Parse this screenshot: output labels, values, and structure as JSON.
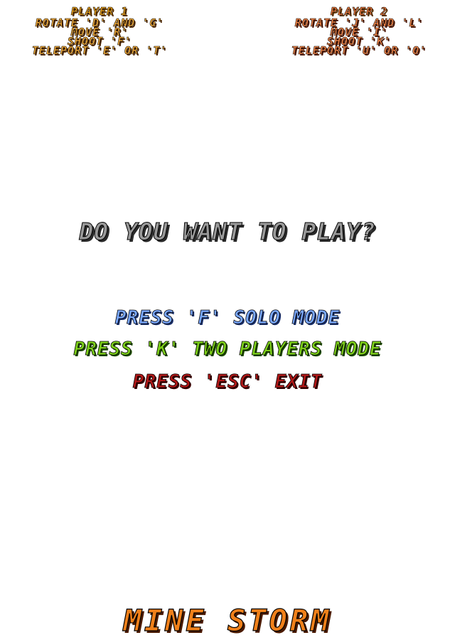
{
  "player1": {
    "title": "PLAYER 1",
    "rotate": "ROTATE 'D' AND 'G'",
    "move": "MOVE 'R'",
    "shoot": "SHOOT 'F'",
    "teleport": "TELEPORT 'E' OR 'T'"
  },
  "player2": {
    "title": "PLAYER 2",
    "rotate": "ROTATE 'J' AND 'L'",
    "move": "MOVE 'I'",
    "shoot": "SHOOT 'K'",
    "teleport": "TELEPORT 'U' OR 'O'"
  },
  "prompt": "DO YOU WANT TO PLAY?",
  "menu": {
    "solo": "PRESS 'F' SOLO MODE",
    "two_players": "PRESS 'K' TWO PLAYERS MODE",
    "exit": "PRESS 'ESC' EXIT"
  },
  "game_title": "MINE STORM",
  "colors": {
    "player_text": "#f2a11d",
    "solo": "#7aa8ff",
    "two_players": "#7ccf1a",
    "exit": "#b01818",
    "prompt": "#9a9a9a",
    "title": "#f0801a"
  }
}
